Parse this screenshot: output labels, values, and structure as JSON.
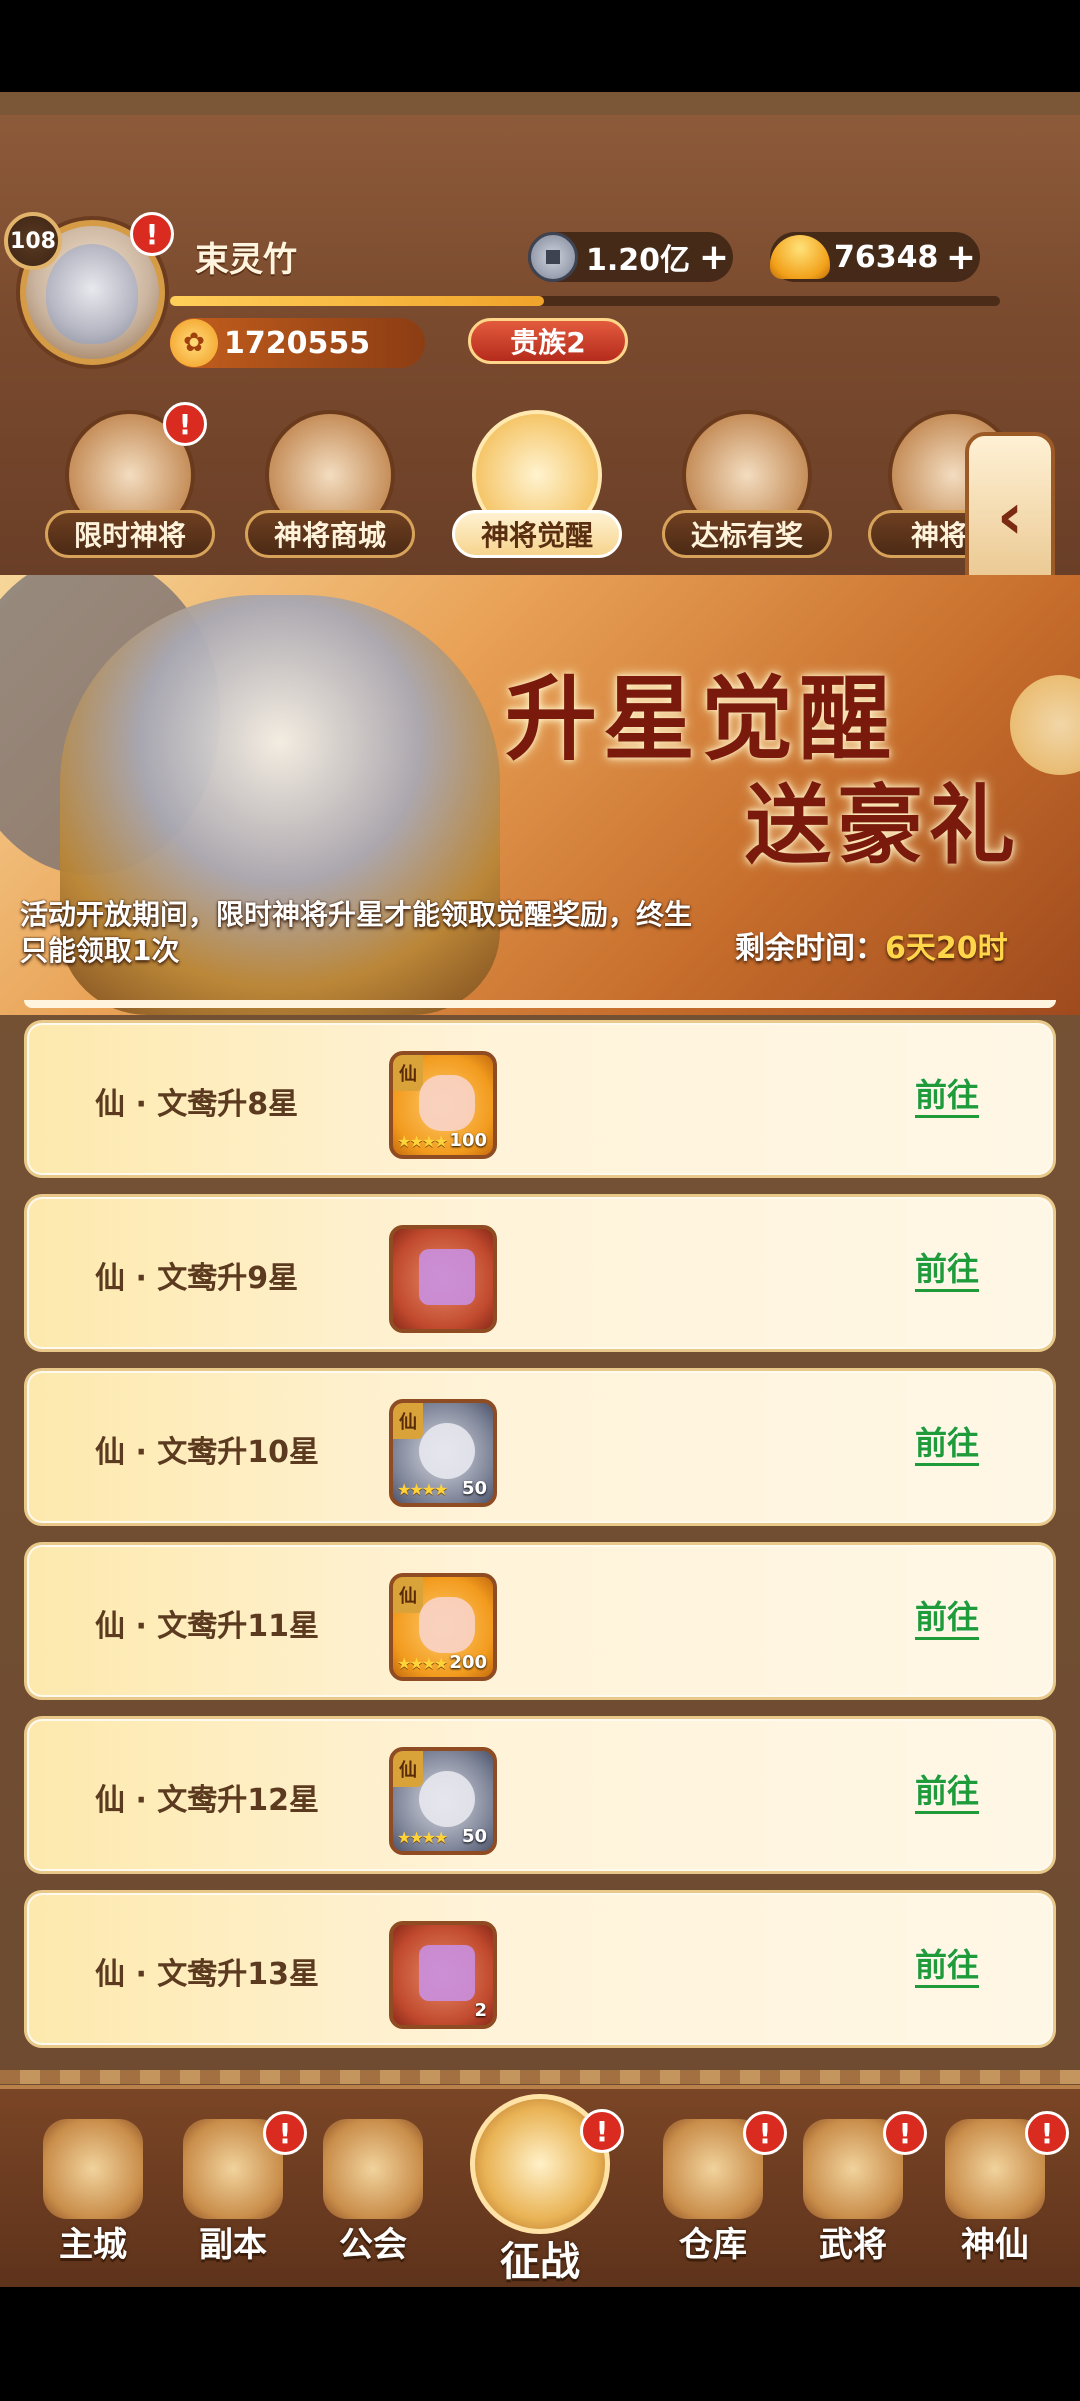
{
  "player": {
    "level": "108",
    "name": "束灵竹",
    "power": "1720555",
    "noble": "贵族2",
    "alert": "!"
  },
  "currency": {
    "coins": "1.20亿",
    "gold": "76348",
    "plus": "+"
  },
  "tabs": [
    {
      "label": "限时神将",
      "icon": "hero-icon",
      "alert": true
    },
    {
      "label": "神将商城",
      "icon": "bag-icon",
      "alert": false
    },
    {
      "label": "神将觉醒",
      "icon": "awaken-hero-icon",
      "alert": false,
      "active": true
    },
    {
      "label": "达标有奖",
      "icon": "reward-pot-icon",
      "alert": false
    },
    {
      "label": "神将礼",
      "icon": "gift-icon",
      "alert": false
    }
  ],
  "side_tab_arrow": "‹",
  "banner": {
    "title_line1": "升星觉醒",
    "title_line2": "送豪礼",
    "description": "活动开放期间，限时神将升星才能领取觉醒奖励，终生只能领取1次",
    "timer_label": "剩余时间：",
    "timer_value": "6天20时"
  },
  "tasks": [
    {
      "title": "仙 · 文鸯升8星",
      "reward_type": "orange",
      "reward_tag": "仙",
      "reward_qty": "100",
      "stars": "★★★★",
      "go": "前往"
    },
    {
      "title": "仙 · 文鸯升9星",
      "reward_type": "red",
      "reward_tag": "",
      "reward_qty": "",
      "stars": "",
      "go": "前往"
    },
    {
      "title": "仙 · 文鸯升10星",
      "reward_type": "gray",
      "reward_tag": "仙",
      "reward_qty": "50",
      "stars": "★★★★",
      "go": "前往"
    },
    {
      "title": "仙 · 文鸯升11星",
      "reward_type": "orange",
      "reward_tag": "仙",
      "reward_qty": "200",
      "stars": "★★★★",
      "go": "前往"
    },
    {
      "title": "仙 · 文鸯升12星",
      "reward_type": "gray",
      "reward_tag": "仙",
      "reward_qty": "50",
      "stars": "★★★★",
      "go": "前往"
    },
    {
      "title": "仙 · 文鸯升13星",
      "reward_type": "red",
      "reward_tag": "",
      "reward_qty": "2",
      "stars": "",
      "go": "前往"
    }
  ],
  "nav": [
    {
      "label": "主城",
      "icon": "city-icon",
      "alert": false
    },
    {
      "label": "副本",
      "icon": "sword-icon",
      "alert": true
    },
    {
      "label": "公会",
      "icon": "flag-icon",
      "alert": false
    },
    {
      "label": "征战",
      "icon": "battle-icon",
      "alert": true
    },
    {
      "label": "仓库",
      "icon": "warehouse-icon",
      "alert": true
    },
    {
      "label": "武将",
      "icon": "general-icon",
      "alert": true
    },
    {
      "label": "神仙",
      "icon": "deity-icon",
      "alert": true
    }
  ]
}
